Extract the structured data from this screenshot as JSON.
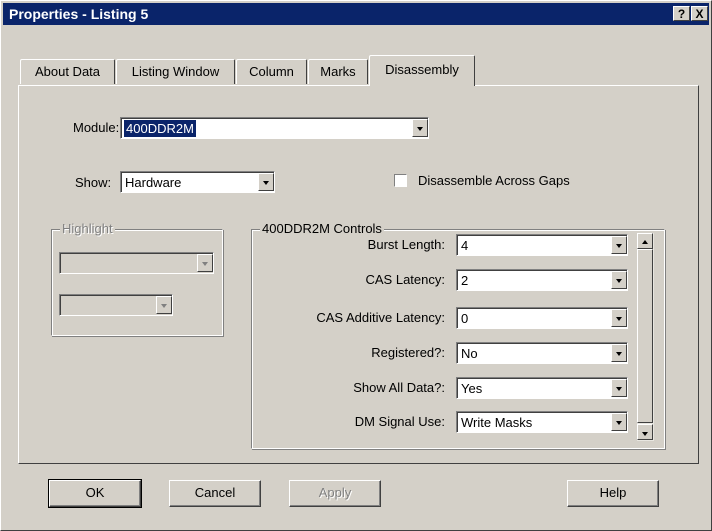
{
  "window": {
    "title": "Properties - Listing 5",
    "help_glyph": "?",
    "close_glyph": "X"
  },
  "tabs": [
    {
      "label": "About Data"
    },
    {
      "label": "Listing Window"
    },
    {
      "label": "Column"
    },
    {
      "label": "Marks"
    },
    {
      "label": "Disassembly",
      "active": true
    }
  ],
  "module": {
    "label": "Module:",
    "value": "400DDR2M"
  },
  "show": {
    "label": "Show:",
    "value": "Hardware"
  },
  "disassemble_gaps": {
    "label": "Disassemble Across Gaps",
    "checked": false
  },
  "highlight": {
    "title": "Highlight",
    "combo1_value": "",
    "combo2_value": ""
  },
  "controls": {
    "title": "400DDR2M Controls",
    "rows": [
      {
        "label": "Burst Length:",
        "value": "4"
      },
      {
        "label": "CAS Latency:",
        "value": "2"
      },
      {
        "label": "CAS Additive Latency:",
        "value": "0"
      },
      {
        "label": "Registered?:",
        "value": "No"
      },
      {
        "label": "Show All Data?:",
        "value": "Yes"
      },
      {
        "label": "DM Signal Use:",
        "value": "Write Masks"
      }
    ]
  },
  "buttons": {
    "ok": "OK",
    "cancel": "Cancel",
    "apply": "Apply",
    "help": "Help"
  },
  "colors": {
    "title_bar": "#0a246a",
    "face": "#d4d0c8",
    "selection": "#0a246a"
  }
}
